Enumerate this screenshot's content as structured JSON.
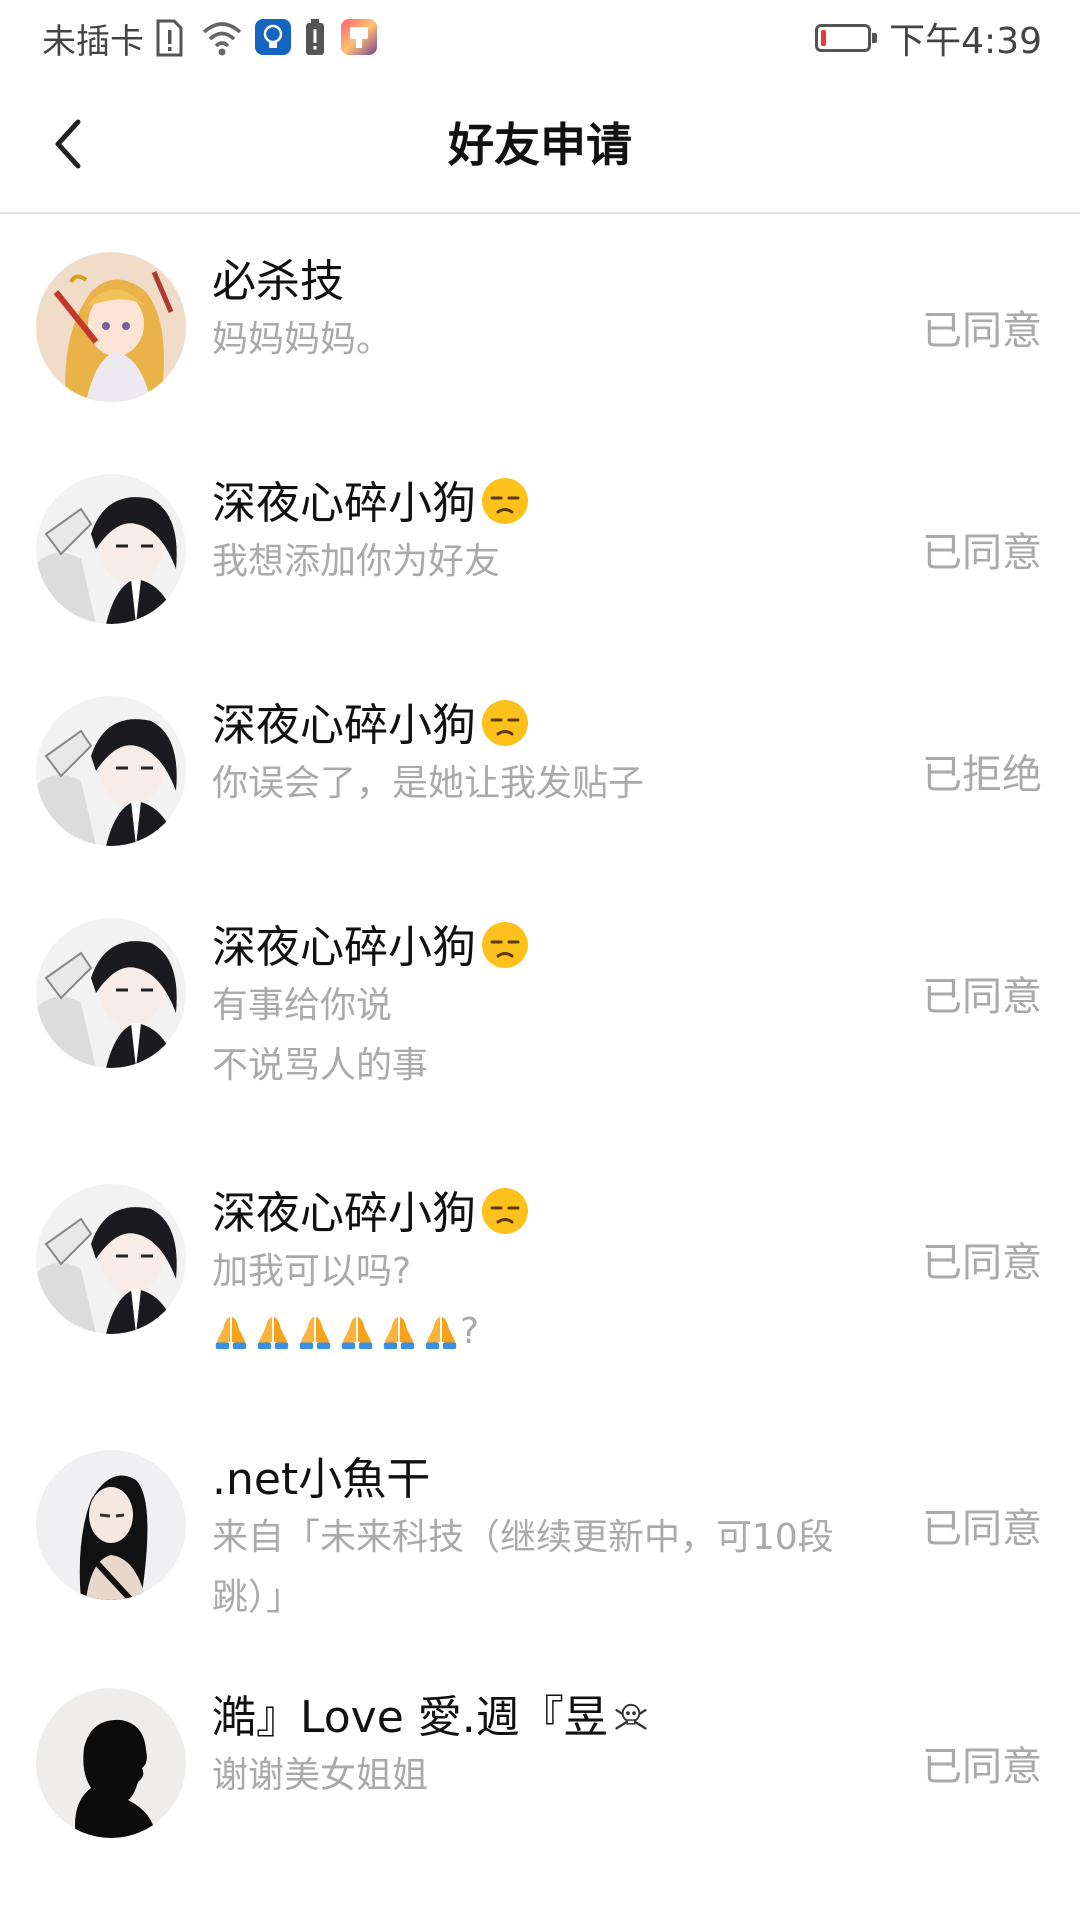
{
  "status_bar": {
    "carrier": "未插卡",
    "time": "下午4:39",
    "battery_level": 0.12,
    "icons": [
      "sim-alert-icon",
      "wifi-icon",
      "bulb-app-icon",
      "battery-alert-icon",
      "colorful-app-icon"
    ]
  },
  "header": {
    "back_icon": "chevron-left-icon",
    "title": "好友申请"
  },
  "requests": [
    {
      "name": "必杀技",
      "messages": [
        "妈妈妈妈。"
      ],
      "status": "已同意",
      "avatar": "anime-girl-blonde"
    },
    {
      "name": "深夜心碎小狗",
      "messages": [
        "我想添加你为好友"
      ],
      "status": "已同意",
      "avatar": "anime-boy-dark-hair"
    },
    {
      "name": "深夜心碎小狗",
      "messages": [
        "你误会了，是她让我发贴子"
      ],
      "status": "已拒绝",
      "avatar": "anime-boy-dark-hair"
    },
    {
      "name": "深夜心碎小狗",
      "messages": [
        "有事给你说",
        "不说骂人的事"
      ],
      "status": "已同意",
      "avatar": "anime-boy-dark-hair"
    },
    {
      "name": "深夜心碎小狗",
      "messages": [
        "加我可以吗?",
        "?"
      ],
      "status": "已同意",
      "avatar": "anime-boy-dark-hair"
    },
    {
      "name": ".net小魚干",
      "messages": [
        "来自「未来科技（继续更新中，可10段",
        "跳）」"
      ],
      "status": "已同意",
      "avatar": "anime-girl-black-hair"
    },
    {
      "name": "澔』Love 愛.週『昱",
      "messages": [
        "谢谢美女姐姐"
      ],
      "status": "已同意",
      "avatar": "silhouette-profile"
    }
  ],
  "emoji": {
    "unamused": "unamused-face-icon",
    "pray": "folded-hands-icon",
    "skull": "skull-crossbones-icon",
    "pray_count": 6
  },
  "colors": {
    "name_text": "#111111",
    "secondary_text": "#aaaaaa",
    "divider": "#e6e6e6",
    "battery_low": "#e53935"
  }
}
